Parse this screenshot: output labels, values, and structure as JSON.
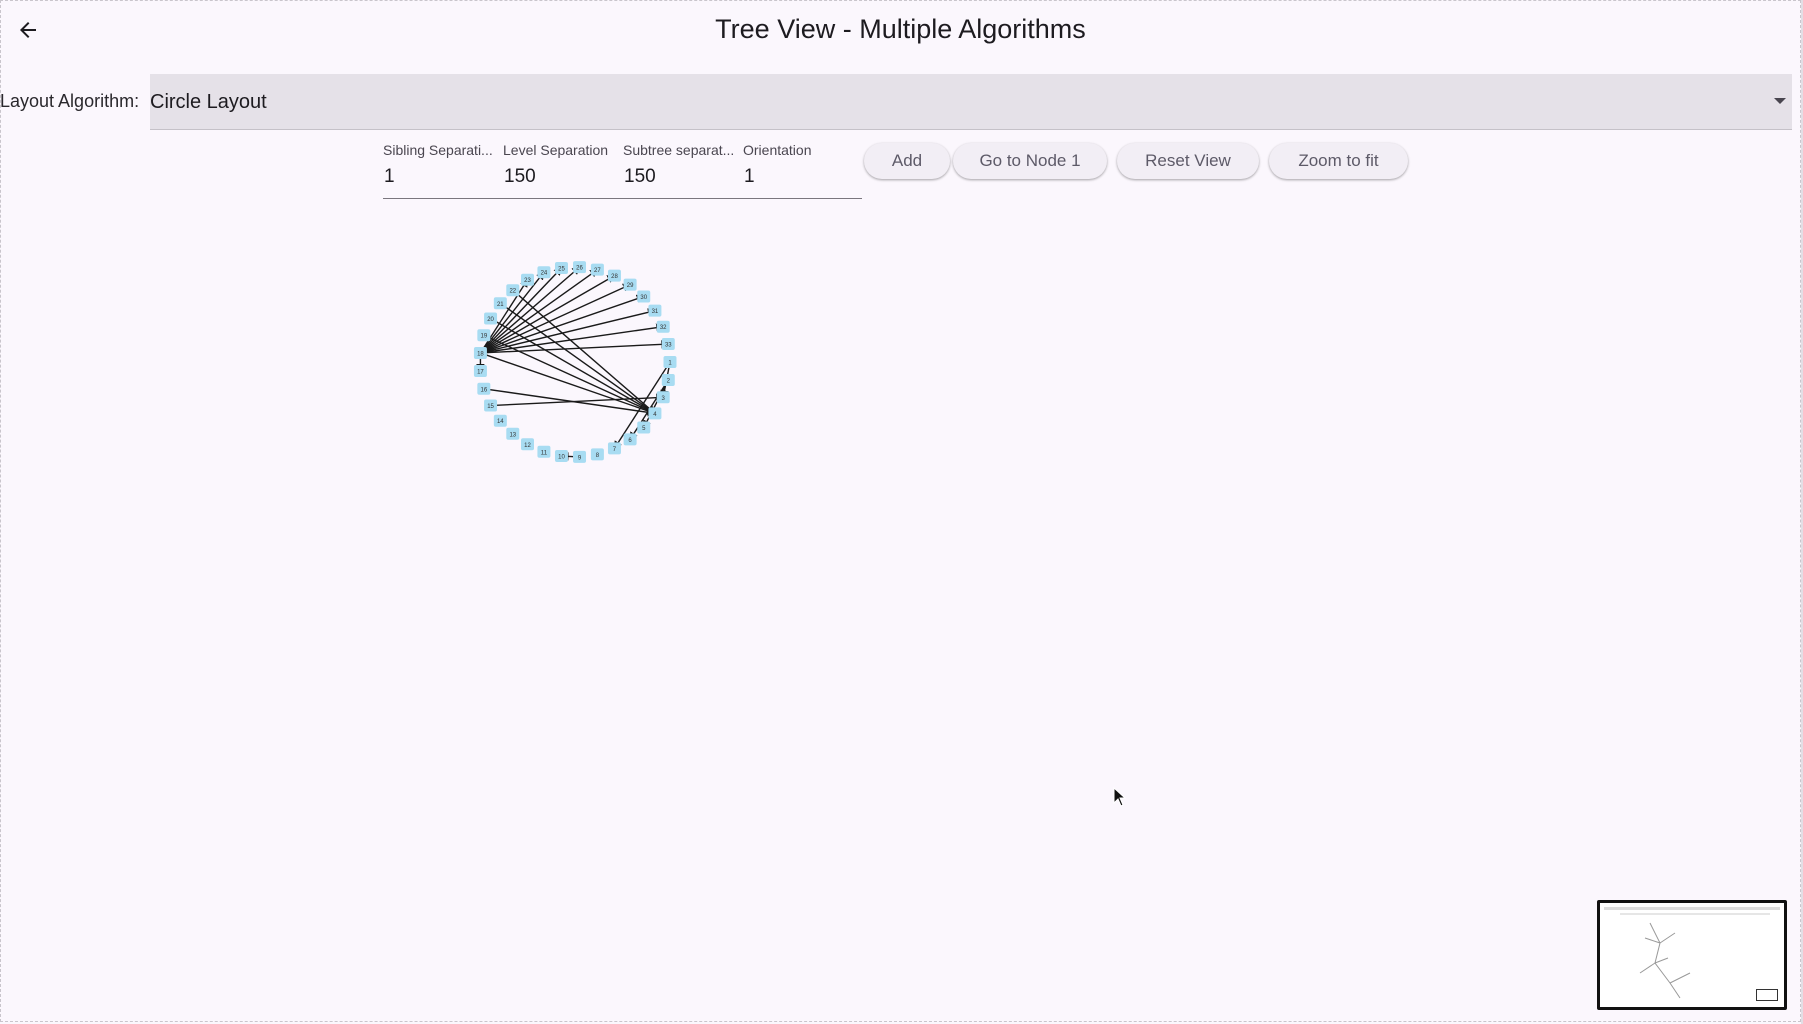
{
  "app_bar": {
    "title": "Tree View - Multiple Algorithms",
    "back_icon": "arrow-back-icon"
  },
  "layout_selector": {
    "label": "Layout Algorithm:",
    "selected": "Circle Layout"
  },
  "config_fields": [
    {
      "label": "Sibling Separati...",
      "value": "1"
    },
    {
      "label": "Level Separation",
      "value": "150"
    },
    {
      "label": "Subtree separat...",
      "value": "150"
    },
    {
      "label": "Orientation",
      "value": "1"
    }
  ],
  "toolbar": {
    "add_label": "Add",
    "goto_label": "Go to Node 1",
    "reset_label": "Reset View",
    "zoom_label": "Zoom to fit"
  },
  "graph": {
    "layout": "circle",
    "node_labels": [
      "1",
      "2",
      "3",
      "4",
      "5",
      "6",
      "7",
      "8",
      "9",
      "10",
      "11",
      "12",
      "13",
      "14",
      "15",
      "16",
      "17",
      "18",
      "19",
      "20",
      "21",
      "22",
      "23",
      "24",
      "25",
      "26",
      "27",
      "28",
      "29",
      "30",
      "31",
      "32",
      "33"
    ],
    "edges": [
      [
        18,
        17
      ],
      [
        18,
        23
      ],
      [
        18,
        24
      ],
      [
        18,
        25
      ],
      [
        18,
        26
      ],
      [
        18,
        27
      ],
      [
        18,
        28
      ],
      [
        18,
        29
      ],
      [
        18,
        30
      ],
      [
        18,
        31
      ],
      [
        18,
        32
      ],
      [
        18,
        33
      ],
      [
        18,
        4
      ],
      [
        19,
        4
      ],
      [
        20,
        4
      ],
      [
        21,
        4
      ],
      [
        22,
        4
      ],
      [
        16,
        4
      ],
      [
        15,
        3
      ],
      [
        1,
        3
      ],
      [
        2,
        5
      ],
      [
        2,
        6
      ],
      [
        1,
        7
      ],
      [
        9,
        10
      ]
    ],
    "node_color": "#a8dcf2",
    "edge_color": "#1a1a1a"
  },
  "minimap": {
    "present": true
  }
}
